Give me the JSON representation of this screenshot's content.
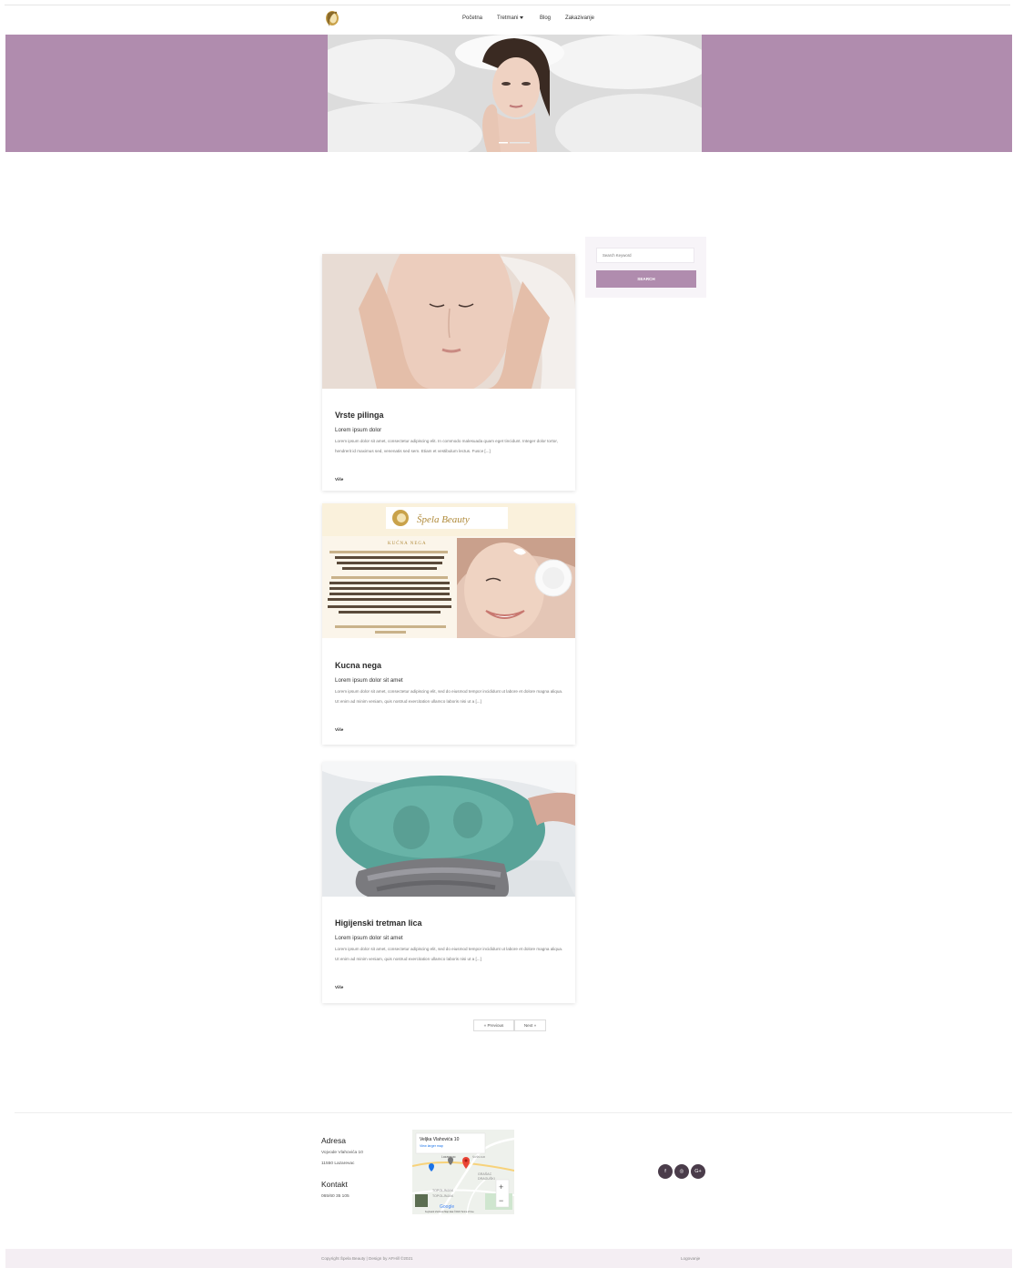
{
  "nav": {
    "items": [
      {
        "label": "Početna"
      },
      {
        "label": "Tretmani"
      },
      {
        "label": "Blog"
      },
      {
        "label": "Zakazivanje"
      }
    ]
  },
  "colors": {
    "accent": "#b08cae",
    "footer_bg": "#f4eef3",
    "social_bg": "#4a3c4a"
  },
  "posts": [
    {
      "title": "Vrste pilinga",
      "subtitle": "Lorem ipsum dolor",
      "excerpt": "Lorem ipsum dolor sit amet, consectetur adipiscing elit. In commodo malesuada quam eget tincidunt. Integer dolor tortor, hendrerit id maximus sed, venenatis sed sem. Etiam et vestibulum lectus. Fusce [...]",
      "more": "Više"
    },
    {
      "title": "Kucna nega",
      "subtitle": "Lorem ipsum dolor sit amet",
      "excerpt": "Lorem ipsum dolor sit amet, consectetur adipiscing elit, sed do eiusmod tempor incididunt ut labore et dolore magna aliqua. Ut enim ad minim veniam, quis nostrud exercitation ullamco laboris nisi ut a [...]",
      "more": "Više",
      "image_text": {
        "brand": "Špela Beauty",
        "heading": "KUĆNA NEGA",
        "p1": "Kućna nega je izuzetno važna. Uz pomoć preparata kožu redovno čistimo, hranimo i štitimo od negativnih spoljnih uticaja.",
        "p2": "Držite se pravila - manje je više. Nije vam potrebno da koristite 20 preparata, ono što je važno da su preparati pravilno odabrani i da znate zašto nanosite koji preparat.",
        "p3": "Preparatima moramo dati vreme da vidimo da li nam odgovaraju.",
        "p4": "Kućna nega zahteva redovnu upotrebu i strpljenje!"
      }
    },
    {
      "title": "Higijenski tretman lica",
      "subtitle": "Lorem ipsum dolor sit amet",
      "excerpt": "Lorem ipsum dolor sit amet, consectetur adipiscing elit, sed do eiusmod tempor incididunt ut labore et dolore magna aliqua. Ut enim ad minim veniam, quis nostrud exercitation ullamco laboris nisi ut a [...]",
      "more": "Više"
    }
  ],
  "sidebar": {
    "search_placeholder": "Search Keyword",
    "search_button": "SEARCH"
  },
  "pagination": {
    "prev": "« Previous",
    "next": "Next »"
  },
  "footer": {
    "address_heading": "Adresa",
    "address_line1": "Vojvode Vlahovića 10",
    "address_line2": "11550 Lazarevac",
    "contact_heading": "Kontakt",
    "phone": "065/60 35 105",
    "map": {
      "place": "Veljka Vlahovića 10",
      "link": "View larger map",
      "labels": [
        "Lazarevac",
        "ŠUŠNJAR",
        "GRAŠAC",
        "DRAGUŠKI",
        "TOPOLJNJAK",
        "TOPOLJNJAK"
      ],
      "zoom_in": "+",
      "zoom_out": "−",
      "google": "Google",
      "credits": "Keyboard shortcuts   Map data ©2021   Terms of Use"
    },
    "social": [
      "f",
      "◎",
      "G+"
    ],
    "copyright": "Copyright Špela Beauty | Design by AFHill ©2021",
    "login": "Logovanje"
  }
}
